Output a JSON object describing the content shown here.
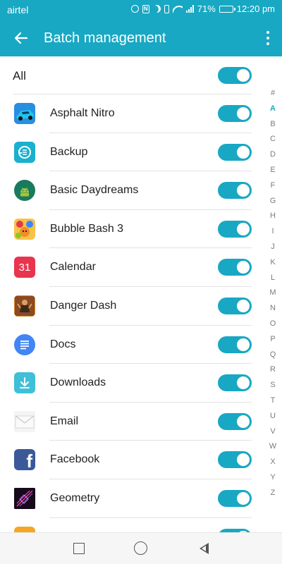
{
  "status_bar": {
    "carrier": "airtel",
    "battery": "71%",
    "time": "12:20 pm",
    "icons": [
      "alarm-icon",
      "nfc-icon",
      "do-not-disturb-icon",
      "vibrate-icon",
      "wifi-icon",
      "signal-icon",
      "battery-icon"
    ]
  },
  "app_bar": {
    "title": "Batch management",
    "back_icon": "arrow-left-icon",
    "menu_icon": "more-vertical-icon"
  },
  "all_row": {
    "label": "All",
    "toggle_on": true
  },
  "apps": [
    {
      "name": "Asphalt Nitro",
      "icon": "asphalt-nitro-icon",
      "enabled": true
    },
    {
      "name": "Backup",
      "icon": "backup-icon",
      "enabled": true
    },
    {
      "name": "Basic Daydreams",
      "icon": "android-icon",
      "enabled": true
    },
    {
      "name": "Bubble Bash 3",
      "icon": "bubble-bash-icon",
      "enabled": true
    },
    {
      "name": "Calendar",
      "icon": "calendar-icon",
      "icon_text": "31",
      "enabled": true
    },
    {
      "name": "Danger Dash",
      "icon": "danger-dash-icon",
      "enabled": true
    },
    {
      "name": "Docs",
      "icon": "docs-icon",
      "enabled": true
    },
    {
      "name": "Downloads",
      "icon": "download-icon",
      "enabled": true
    },
    {
      "name": "Email",
      "icon": "email-icon",
      "enabled": true
    },
    {
      "name": "Facebook",
      "icon": "facebook-icon",
      "icon_text": "f",
      "enabled": true
    },
    {
      "name": "Geometry",
      "icon": "geometry-icon",
      "enabled": true
    },
    {
      "name": "",
      "icon": "health-icon",
      "enabled": true
    }
  ],
  "alpha_index": [
    "#",
    "A",
    "B",
    "C",
    "D",
    "E",
    "F",
    "G",
    "H",
    "I",
    "J",
    "K",
    "L",
    "M",
    "N",
    "O",
    "P",
    "Q",
    "R",
    "S",
    "T",
    "U",
    "V",
    "W",
    "X",
    "Y",
    "Z"
  ],
  "alpha_active": "A",
  "nav_bar": {
    "buttons": [
      "recents-button",
      "home-button",
      "back-button"
    ]
  },
  "colors": {
    "accent": "#18a8c3",
    "toggle_on": "#18a8c3",
    "divider": "#e2e2e2"
  }
}
